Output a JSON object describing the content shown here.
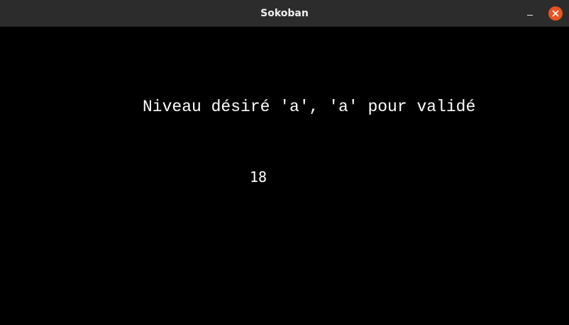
{
  "window": {
    "title": "Sokoban",
    "controls": {
      "minimize_icon": "minimize-icon",
      "close_icon": "close-icon",
      "close_color": "#e95420"
    }
  },
  "game": {
    "prompt": "Niveau désiré 'a', 'a' pour validé",
    "level_input": "18",
    "background_color": "#000000",
    "text_color": "#ffffff"
  }
}
